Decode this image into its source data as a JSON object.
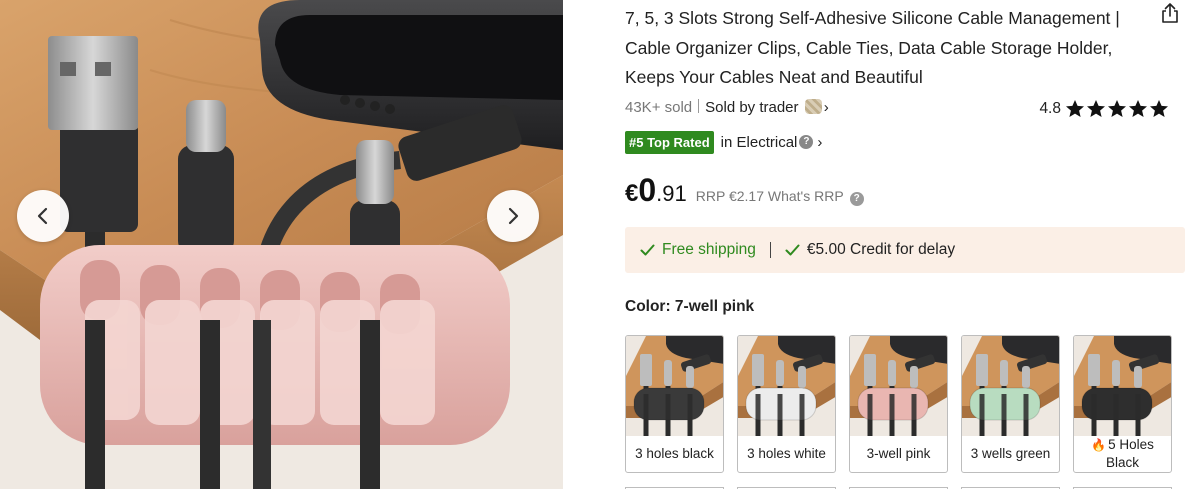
{
  "product": {
    "title": "7, 5, 3 Slots Strong Self-Adhesive Silicone Cable Management | Cable Organizer Clips, Cable Ties, Data Cable Storage Holder, Keeps Your Cables Neat and Beautiful",
    "sold": "43K+ sold",
    "seller": "Sold by trader",
    "rating": "4.8",
    "rating_stars": 5,
    "rank_badge": "#5 Top Rated",
    "rank_category": "in Electrical",
    "price": {
      "currency": "€",
      "integer": "0",
      "decimal": ".91",
      "rrp": "RRP €2.17 What's RRP"
    },
    "shipping": {
      "free": "Free shipping",
      "credit": "€5.00 Credit for delay"
    },
    "color_label": "Color: 7-well pink",
    "variants": [
      {
        "label": "3 holes black",
        "hot": false,
        "clip_color": "#3a3a3a"
      },
      {
        "label": "3 holes white",
        "hot": false,
        "clip_color": "#ececec"
      },
      {
        "label": "3-well pink",
        "hot": false,
        "clip_color": "#e9b6b1"
      },
      {
        "label": "3 wells green",
        "hot": false,
        "clip_color": "#b8dcc0"
      },
      {
        "label": "5 Holes Black",
        "hot": true,
        "clip_color": "#2e2e2e"
      }
    ]
  },
  "icons": {
    "share": "share-icon",
    "prev": "chevron-left-icon",
    "next": "chevron-right-icon",
    "star": "star-icon",
    "check": "check-icon",
    "help": "help-circle-icon",
    "fire": "fire-icon"
  },
  "colors": {
    "accent_green": "#2f8a1f",
    "ship_bg": "#fbefe6",
    "clip_pink": "#e9b9b5"
  }
}
